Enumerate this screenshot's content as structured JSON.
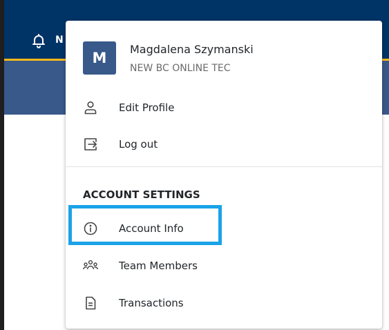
{
  "header": {
    "notifications_label": "N",
    "bell_icon": "bell-icon"
  },
  "user": {
    "initial": "M",
    "name": "Magdalena Szymanski",
    "organization": "NEW BC ONLINE TEC"
  },
  "menu": {
    "edit_profile": "Edit Profile",
    "log_out": "Log out",
    "section_title": "ACCOUNT SETTINGS",
    "account_info": "Account Info",
    "team_members": "Team Members",
    "transactions": "Transactions"
  },
  "colors": {
    "header_bg": "#003366",
    "subheader_bg": "#38598a",
    "accent_gold": "#fcba19",
    "highlight": "#1aa3e8",
    "avatar_bg": "#38598a"
  }
}
